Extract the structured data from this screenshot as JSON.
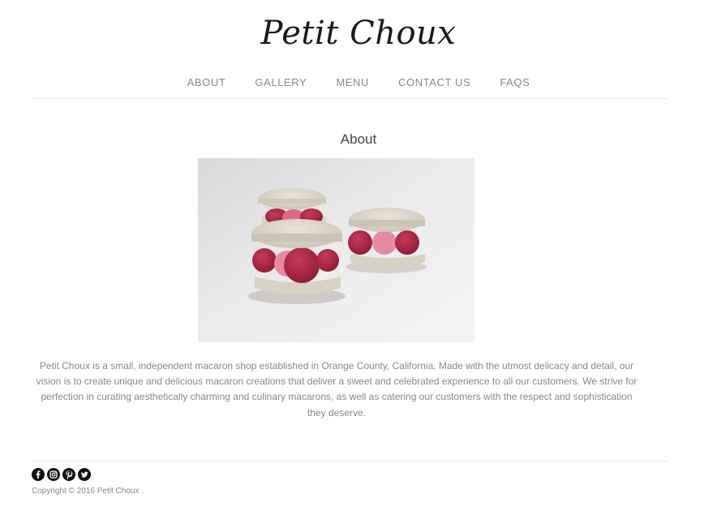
{
  "brand": {
    "name": "Petit Choux"
  },
  "nav": {
    "items": [
      "ABOUT",
      "GALLERY",
      "MENU",
      "CONTACT US",
      "FAQS"
    ]
  },
  "about": {
    "title": "About",
    "image_alt": "macarons-photo",
    "text": "Petit Choux is a small, independent macaron shop established in Orange County, California. Made with the utmost delicacy and detail, our vision is to create unique and delicious macaron creations that deliver a sweet and celebrated experience to all our customers. We strive for perfection in curating aesthetically charming and culinary macarons, as well as catering our customers with the respect and sophistication they deserve."
  },
  "footer": {
    "social_icons": [
      "facebook-icon",
      "instagram-icon",
      "pinterest-icon",
      "twitter-icon"
    ],
    "copyright": "Copyright © 2016 Petit Choux ."
  }
}
